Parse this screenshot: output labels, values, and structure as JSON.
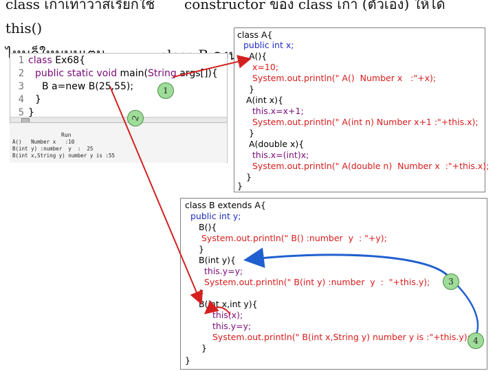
{
  "heading": {
    "line1_left": "class เก่าเท่าวาสเรียกใช้",
    "line1_right": "constructor ของ class เก่า (ตัวเอง) ให้ได้",
    "line2": "this()",
    "line3_left": "ไหนก็ใหมนุษเตม",
    "line3_mid": "class B คงน"
  },
  "ide": {
    "lines": [
      "1",
      "2",
      "3",
      "4",
      "5"
    ],
    "code": {
      "l1_kw": "class",
      "l1_rest": " Ex68{",
      "l2_kw": "public static void",
      "l2_mid": " main(",
      "l2_type": "String",
      "l2_rest": " args[]){",
      "l3": "B a=new B(25,55);",
      "l4": "}",
      "l5": "}"
    },
    "console_title": "Run",
    "console_lines": [
      "A()   Number x   :10",
      "B(int y) :number  y  :  25",
      "B(int x,String y) number y is :55"
    ]
  },
  "class_a": {
    "lines": [
      "class A{",
      "public int x;",
      "A(){",
      "x=10;",
      "System.out.println(\" A()  Number x   :\"+x);",
      "}",
      "A(int x){",
      "this.x=x+1;",
      "System.out.println(\" A(int n) Number x+1 :\"+this.x);",
      "}",
      "A(double x){",
      "this.x=(int)x;",
      "System.out.println(\" A(double n)  Number x  :\"+this.x);",
      "}",
      "}"
    ]
  },
  "class_b": {
    "lines": [
      "class B extends A{",
      "public int y;",
      "B(){",
      "System.out.println(\" B() :number  y  : \"+y);",
      "}",
      "B(int y){",
      "this.y=y;",
      "System.out.println(\" B(int y) :number  y  :  \"+this.y);",
      "}",
      "B(int x,int y){",
      "this(x);",
      "this.y=y;",
      "System.out.println(\" B(int x,String y) number y is :\"+this.y);",
      "}",
      "}"
    ]
  },
  "badges": [
    "1",
    "2",
    "3",
    "4"
  ],
  "colors": {
    "arrow_red": "#d42020",
    "arrow_blue": "#1f5fd0",
    "badge_fill": "#9fdc9a"
  }
}
